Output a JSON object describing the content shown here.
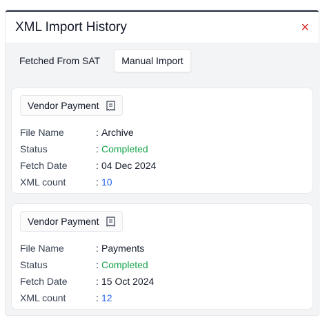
{
  "modal": {
    "title": "XML Import History",
    "close_glyph": "×"
  },
  "tabs": [
    {
      "label": "Fetched From SAT",
      "active": false
    },
    {
      "label": "Manual Import",
      "active": true
    }
  ],
  "colors": {
    "status_green": "#16a34a",
    "count_blue": "#2563eb",
    "close_red": "#dc2626"
  },
  "labels": {
    "file_name": "File Name",
    "status": "Status",
    "fetch_date": "Fetch Date",
    "xml_count": "XML count",
    "separator": ":"
  },
  "records": [
    {
      "type": "Vendor Payment",
      "icon": "receipt-icon",
      "file_name": "Archive",
      "status": "Completed",
      "fetch_date": "04 Dec 2024",
      "xml_count": "10"
    },
    {
      "type": "Vendor Payment",
      "icon": "receipt-icon",
      "file_name": "Payments",
      "status": "Completed",
      "fetch_date": "15 Oct 2024",
      "xml_count": "12"
    }
  ]
}
